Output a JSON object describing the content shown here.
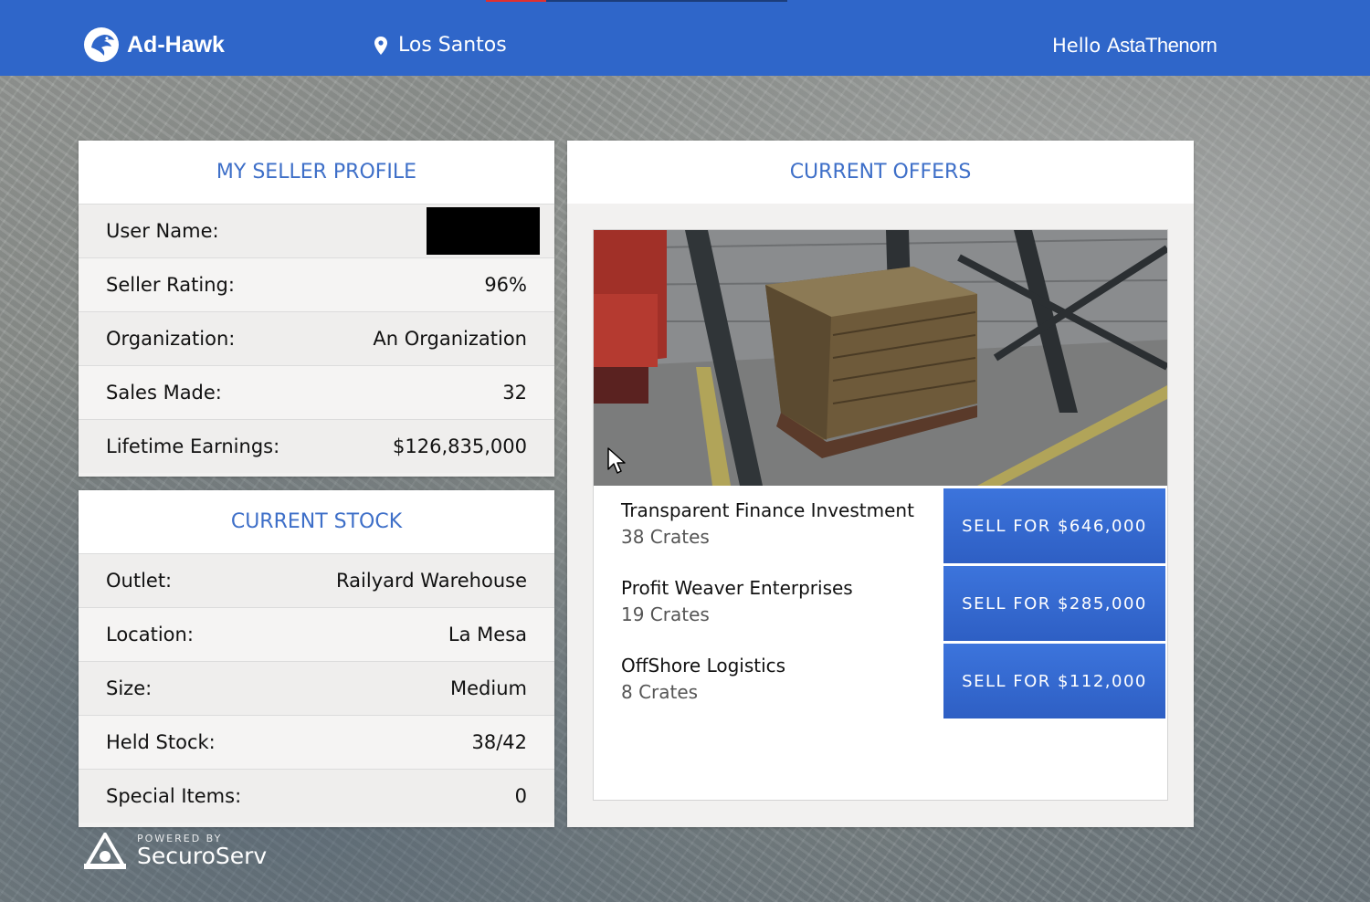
{
  "header": {
    "brand": "Ad-Hawk",
    "location": "Los Santos",
    "greeting": "Hello",
    "username": "AstaThenorn",
    "progress": 0.2
  },
  "profile": {
    "title": "MY SELLER PROFILE",
    "rows": [
      {
        "label": "User Name:",
        "value": ""
      },
      {
        "label": "Seller Rating:",
        "value": "96%"
      },
      {
        "label": "Organization:",
        "value": "An Organization"
      },
      {
        "label": "Sales Made:",
        "value": "32"
      },
      {
        "label": "Lifetime Earnings:",
        "value": "$126,835,000"
      }
    ]
  },
  "stock": {
    "title": "CURRENT STOCK",
    "rows": [
      {
        "label": "Outlet:",
        "value": "Railyard Warehouse"
      },
      {
        "label": "Location:",
        "value": "La Mesa"
      },
      {
        "label": "Size:",
        "value": "Medium"
      },
      {
        "label": "Held Stock:",
        "value": "38/42"
      },
      {
        "label": "Special Items:",
        "value": "0"
      }
    ]
  },
  "offers": {
    "title": "CURRENT OFFERS",
    "items": [
      {
        "buyer": "Transparent Finance Investment",
        "quantity": "38 Crates",
        "button": "SELL FOR $646,000"
      },
      {
        "buyer": "Profit Weaver Enterprises",
        "quantity": "19 Crates",
        "button": "SELL FOR $285,000"
      },
      {
        "buyer": "OffShore Logistics",
        "quantity": "8 Crates",
        "button": "SELL FOR $112,000"
      }
    ]
  },
  "footer": {
    "powered_by": "POWERED BY",
    "brand": "SecuroServ"
  },
  "colors": {
    "header": "#2f66c9",
    "title_text": "#3e6fc8",
    "button": "#2e5fc4"
  }
}
